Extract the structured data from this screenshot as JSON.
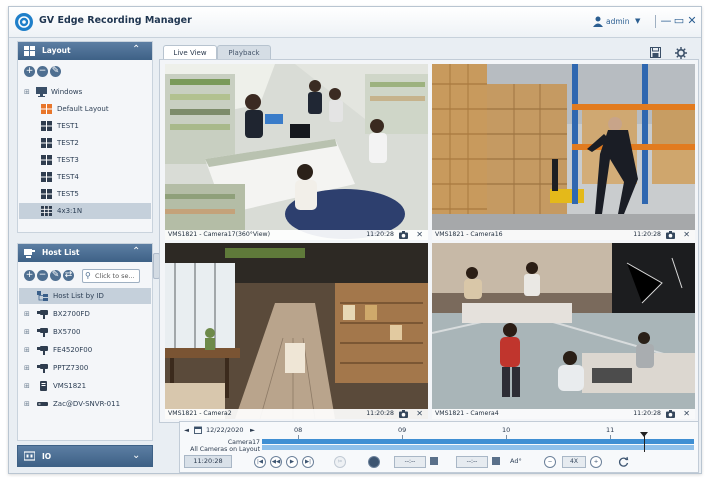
{
  "app": {
    "title": "GV Edge Recording Manager",
    "user": "admin",
    "user_caret": "▼"
  },
  "window_controls": {
    "minimize": "—",
    "maximize": "▭",
    "close": "✕"
  },
  "layout_panel": {
    "header": "Layout",
    "items": [
      {
        "label": "Windows",
        "icon": "monitor-icon",
        "expander": "⊞"
      },
      {
        "label": "Default Layout",
        "icon": "grid-orange-icon"
      },
      {
        "label": "TEST1",
        "icon": "grid-icon"
      },
      {
        "label": "TEST2",
        "icon": "grid-icon"
      },
      {
        "label": "TEST3",
        "icon": "grid-icon"
      },
      {
        "label": "TEST4",
        "icon": "grid-icon"
      },
      {
        "label": "TEST5",
        "icon": "grid-icon"
      },
      {
        "label": "4x3:1N",
        "icon": "grid-icon",
        "selected": true
      }
    ]
  },
  "host_panel": {
    "header": "Host List",
    "search_placeholder": "Click to se...",
    "items": [
      {
        "label": "Host List by ID",
        "icon": "host-tree-icon",
        "selected": true
      },
      {
        "label": "BX2700FD",
        "icon": "camera-icon",
        "expander": "⊞"
      },
      {
        "label": "BX5700",
        "icon": "camera-icon",
        "expander": "⊞"
      },
      {
        "label": "FE4520F00",
        "icon": "camera-icon",
        "expander": "⊞"
      },
      {
        "label": "PPTZ7300",
        "icon": "camera-icon",
        "expander": "⊞"
      },
      {
        "label": "VMS1821",
        "icon": "server-icon",
        "expander": "⊞"
      },
      {
        "label": "Zac@DV-SNVR-011",
        "icon": "nvr-icon",
        "expander": "⊞"
      }
    ]
  },
  "io_panel": {
    "header": "IO"
  },
  "tabs": [
    {
      "label": "Live View"
    },
    {
      "label": "Playback"
    }
  ],
  "cameras": [
    {
      "name": "VMS1821 - Camera17(360°View)",
      "time": "11:20:28"
    },
    {
      "name": "VMS1821 - Camera16",
      "time": "11:20:28"
    },
    {
      "name": "VMS1821 - Camera2",
      "time": "11:20:28"
    },
    {
      "name": "VMS1821 - Camera4",
      "time": "11:20:28"
    }
  ],
  "timeline": {
    "prev": "◄",
    "date": "12/22/2020",
    "next": "►",
    "ticks": [
      "08",
      "09",
      "10",
      "11"
    ],
    "tracks": [
      "Camera17",
      "All Cameras on Layout"
    ],
    "current_time": "11:20:28",
    "fields": [
      "--:--",
      "--:--"
    ],
    "zoom_label": "4X",
    "audio_label": "Ad°"
  },
  "colors": {
    "accent": "#3e6186",
    "track_primary": "#3f8fd3",
    "track_secondary": "#8fc0ea"
  }
}
